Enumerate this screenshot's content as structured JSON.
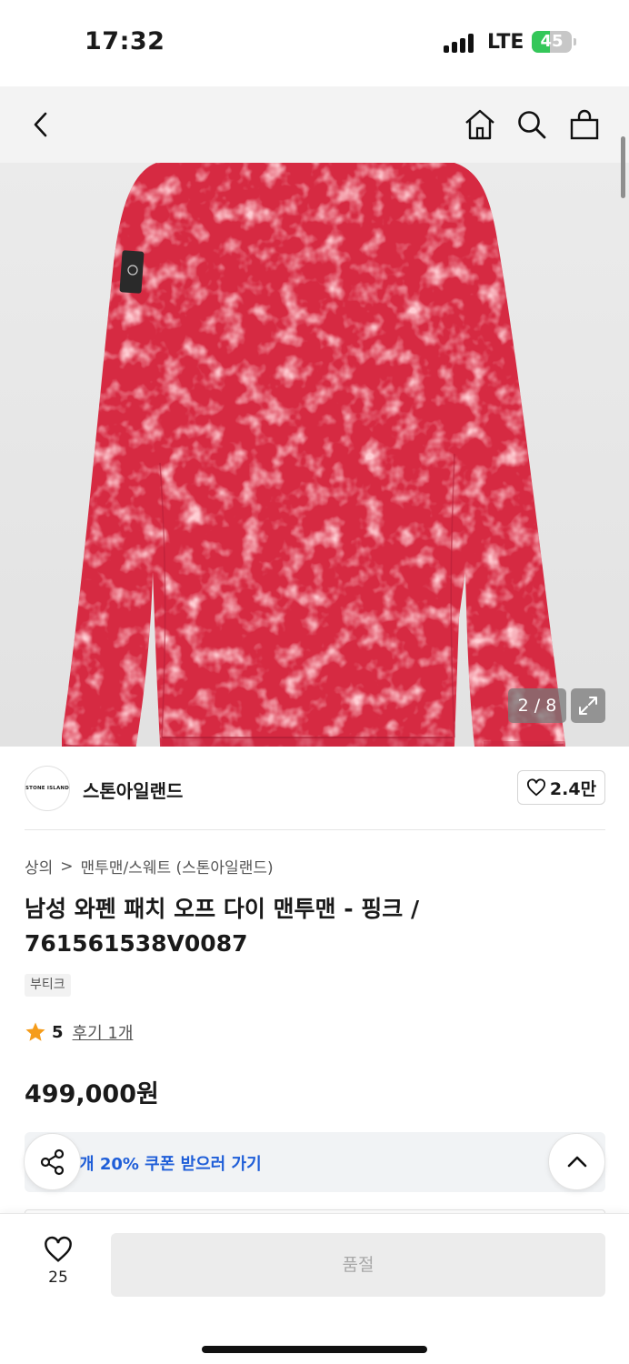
{
  "status_bar": {
    "time": "17:32",
    "network": "LTE",
    "battery": "45",
    "battery_level": 0.45
  },
  "nav": {
    "back_icon": "chevron-left-icon",
    "home_icon": "home-icon",
    "search_icon": "search-icon",
    "cart_icon": "shopping-bag-icon"
  },
  "gallery": {
    "counter": "2 / 8",
    "expand_icon": "expand-icon"
  },
  "brand": {
    "logo_text": "STONE ISLAND",
    "name": "스톤아일랜드",
    "likes": "2.4만"
  },
  "breadcrumb": {
    "category": "상의",
    "separator": ">",
    "subcategory": "맨투맨/스웨트 (스톤아일랜드)"
  },
  "product": {
    "title": "남성 와펜 패치 오프 다이 맨투맨 - 핑크 / 761561538V0087",
    "tag": "부티크",
    "rating": "5",
    "review_link": "후기 1개",
    "price": "499,000원"
  },
  "coupon": {
    "text": "개 20% 쿠폰 받으러 가기",
    "color": "#1f5ed8"
  },
  "bottom_bar": {
    "wish_count": "25",
    "soldout_label": "품절"
  },
  "colors": {
    "garment": "#d62a42",
    "star": "#f59c1a"
  }
}
